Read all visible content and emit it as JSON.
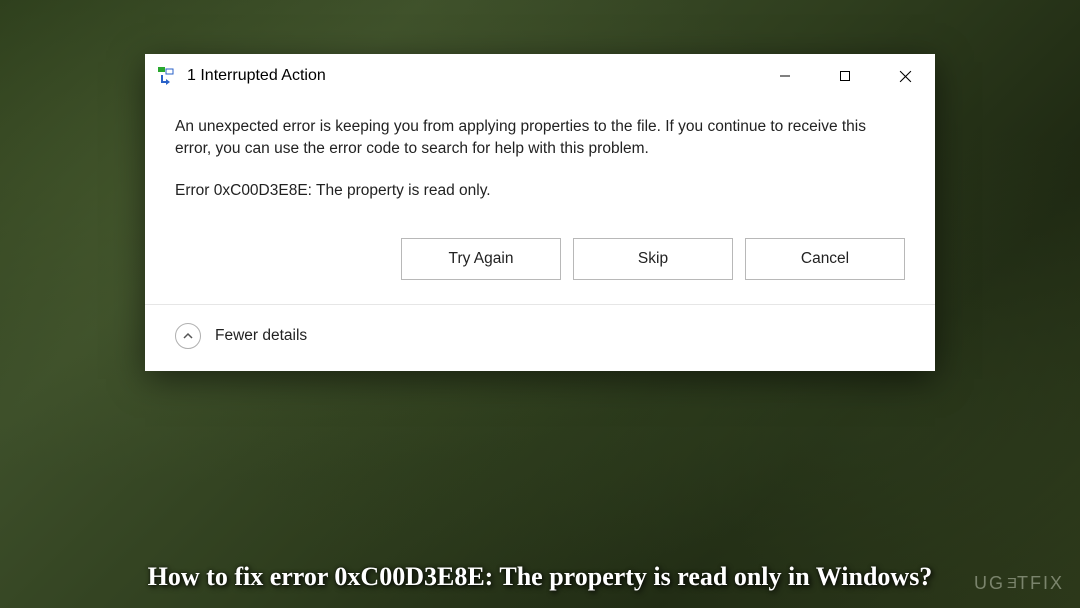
{
  "dialog": {
    "title": "1 Interrupted Action",
    "message": "An unexpected error is keeping you from applying properties to the file. If you continue to receive this error, you can use the error code to search for help with this problem.",
    "error_line": "Error 0xC00D3E8E: The property is read only.",
    "buttons": {
      "try_again": "Try Again",
      "skip": "Skip",
      "cancel": "Cancel"
    },
    "details_toggle": "Fewer details"
  },
  "caption": "How to fix error 0xC00D3E8E: The property is read only in Windows?",
  "watermark": "UGETFIX"
}
